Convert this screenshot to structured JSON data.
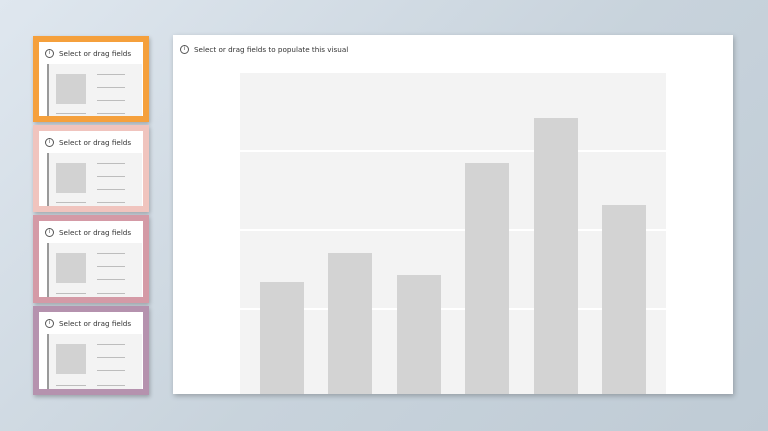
{
  "cards": [
    {
      "title": "Select or drag fields",
      "border_color": "#f5a03c"
    },
    {
      "title": "Select or drag fields",
      "border_color": "#f0c4be"
    },
    {
      "title": "Select or drag fields",
      "border_color": "#d49aa6"
    },
    {
      "title": "Select or drag fields",
      "border_color": "#b592ae"
    }
  ],
  "main": {
    "title": "Select or drag fields to populate this visual",
    "info_icon": "info-icon"
  },
  "chart_data": {
    "type": "bar",
    "values": [
      35,
      44,
      37,
      72,
      86,
      59
    ],
    "ylim": [
      0,
      100
    ],
    "grid": true,
    "bar_color": "#d3d3d3"
  }
}
